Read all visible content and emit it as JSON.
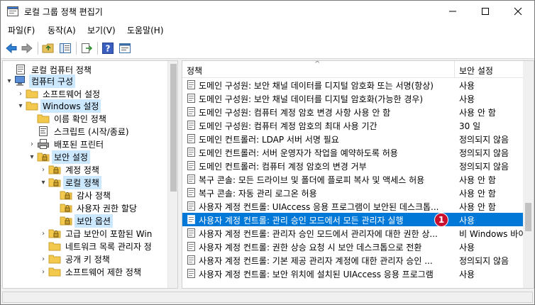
{
  "window": {
    "title": "로컬 그룹 정책 편집기"
  },
  "menu": [
    {
      "label": "파일(F)"
    },
    {
      "label": "동작(A)"
    },
    {
      "label": "보기(V)"
    },
    {
      "label": "도움말(H)"
    }
  ],
  "toolbar_icons": [
    "back-arrow-icon",
    "forward-arrow-icon",
    "up-folder-icon",
    "show-hide-tree-icon",
    "export-list-icon",
    "help-icon",
    "properties-icon"
  ],
  "tree": [
    {
      "label": "로컬 컴퓨터 정책",
      "icon": "policy-doc-icon",
      "level": 0,
      "expander": "",
      "selected": false
    },
    {
      "label": "컴퓨터 구성",
      "icon": "computer-icon",
      "level": 0,
      "expander": "▾",
      "selected": true
    },
    {
      "label": "소프트웨어 설정",
      "icon": "folder-icon",
      "level": 1,
      "expander": "›",
      "selected": false
    },
    {
      "label": "Windows 설정",
      "icon": "folder-icon",
      "level": 1,
      "expander": "▾",
      "selected": true
    },
    {
      "label": "이름 확인 정책",
      "icon": "folder-icon",
      "level": 2,
      "expander": "",
      "selected": false
    },
    {
      "label": "스크립트 (시작/종료)",
      "icon": "script-icon",
      "level": 2,
      "expander": "",
      "selected": false
    },
    {
      "label": "배포된 프린터",
      "icon": "printer-icon",
      "level": 2,
      "expander": "›",
      "selected": false
    },
    {
      "label": "보안 설정",
      "icon": "security-folder-icon",
      "level": 2,
      "expander": "▾",
      "selected": true
    },
    {
      "label": "계정 정책",
      "icon": "security-folder-icon",
      "level": 3,
      "expander": "›",
      "selected": false
    },
    {
      "label": "로컬 정책",
      "icon": "security-folder-icon",
      "level": 3,
      "expander": "▾",
      "selected": true
    },
    {
      "label": "감사 정책",
      "icon": "security-folder-icon",
      "level": 4,
      "expander": "",
      "selected": false
    },
    {
      "label": "사용자 권한 할당",
      "icon": "security-folder-icon",
      "level": 4,
      "expander": "",
      "selected": false
    },
    {
      "label": "보안 옵션",
      "icon": "security-folder-icon",
      "level": 4,
      "expander": "",
      "selected": true
    },
    {
      "label": "고급 보안이 포함된 Win",
      "icon": "security-folder-icon",
      "level": 3,
      "expander": "›",
      "selected": false
    },
    {
      "label": "네트워크 목록 관리자 정",
      "icon": "folder-icon",
      "level": 3,
      "expander": "",
      "selected": false
    },
    {
      "label": "공개 키 정책",
      "icon": "folder-icon",
      "level": 3,
      "expander": "›",
      "selected": false
    },
    {
      "label": "소프트웨어 제한 정책",
      "icon": "folder-icon",
      "level": 3,
      "expander": "›",
      "selected": false
    }
  ],
  "list": {
    "headers": {
      "policy": "정책",
      "setting": "보안 설정"
    },
    "rows": [
      {
        "name": "도메인 구성원: 보안 채널 데이터를 디지털 암호화 또는 서명(항상)",
        "setting": "사용"
      },
      {
        "name": "도메인 구성원: 보안 채널 데이터를 디지털 암호화(가능한 경우)",
        "setting": "사용"
      },
      {
        "name": "도메인 구성원: 컴퓨터 계정 암호 변경 사항 사용 안 함",
        "setting": "사용 안 함"
      },
      {
        "name": "도메인 구성원: 컴퓨터 계정 암호의 최대 사용 기간",
        "setting": "30 일"
      },
      {
        "name": "도메인 컨트롤러: LDAP 서버 서명 필요",
        "setting": "정의되지 않음"
      },
      {
        "name": "도메인 컨트롤러: 서버 운영자가 작업을 예약하도록 허용",
        "setting": "정의되지 않음"
      },
      {
        "name": "도메인 컨트롤러: 컴퓨터 계정 암호의 변경 거부",
        "setting": "정의되지 않음"
      },
      {
        "name": "복구 콘솔: 모든 드라이브 및 폴더에 플로피 복사 및 액세스 허용",
        "setting": "사용 안 함"
      },
      {
        "name": "복구 콘솔: 자동 관리 로그온 허용",
        "setting": "사용 안 함"
      },
      {
        "name": "사용자 계정 컨트롤: UIAccess 응용 프로그램이 보안된 데스크톱...",
        "setting": "사용 안 함"
      },
      {
        "name": "사용자 계정 컨트롤: 관리 승인 모드에서 모든 관리자 실행",
        "setting": "사용",
        "highlight": true
      },
      {
        "name": "사용자 계정 컨트롤: 관리자 승인 모드에서 관리자에 대한 권한 상...",
        "setting": "비 Windows 바이"
      },
      {
        "name": "사용자 계정 컨트롤: 권한 상승 요청 시 보안 데스크톱으로 전환",
        "setting": "사용"
      },
      {
        "name": "사용자 계정 컨트롤: 기본 제공 관리자 계정에 대한 관리자 승인 ...",
        "setting": "정의되지 않음"
      },
      {
        "name": "사용자 계정 컨트롤: 보안 위치에 설치된 UIAccess 응용 프로그램",
        "setting": "사용"
      }
    ]
  },
  "annotation": {
    "label": "1"
  },
  "colors": {
    "highlight": "#0078d7",
    "tree_selection": "#cce8ff",
    "badge": "#c8102e"
  }
}
